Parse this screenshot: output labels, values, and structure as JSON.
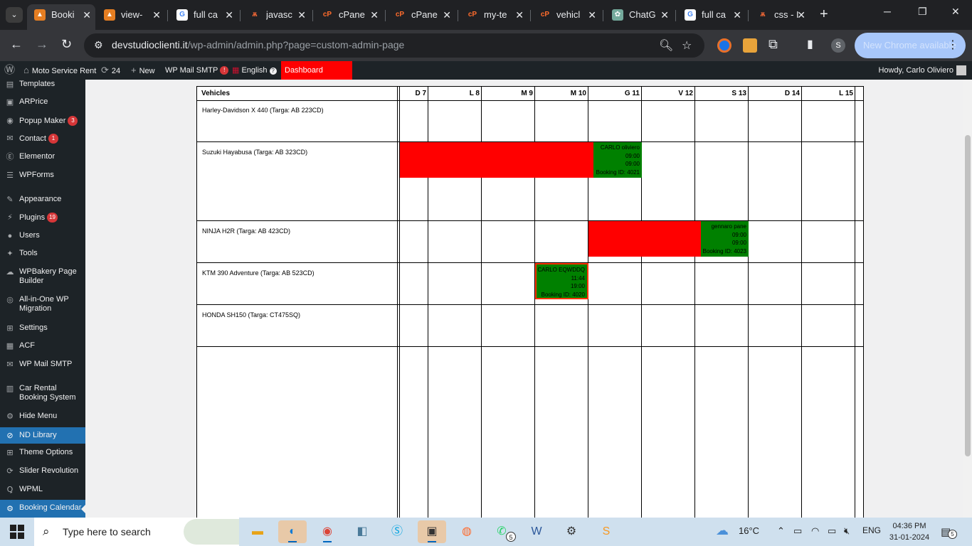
{
  "browser": {
    "tabs": [
      {
        "title": "Booki",
        "favicon": "orange-icon",
        "active": true
      },
      {
        "title": "view-",
        "favicon": "orange-icon"
      },
      {
        "title": "full ca",
        "favicon": "google-icon"
      },
      {
        "title": "javasc",
        "favicon": "dev-icon"
      },
      {
        "title": "cPane",
        "favicon": "cpanel-icon"
      },
      {
        "title": "cPane",
        "favicon": "cpanel-icon"
      },
      {
        "title": "my-te",
        "favicon": "cpanel-icon"
      },
      {
        "title": "vehicl",
        "favicon": "cpanel-icon"
      },
      {
        "title": "ChatG",
        "favicon": "chatgpt-icon"
      },
      {
        "title": "full ca",
        "favicon": "google-icon"
      },
      {
        "title": "css - I",
        "favicon": "dev-icon"
      }
    ],
    "url_domain": "devstudioclienti.it",
    "url_path": "/wp-admin/admin.php?page=custom-admin-page",
    "profile_initial": "S",
    "update_label": "New Chrome available"
  },
  "wp_bar": {
    "site_name": "Moto Service Rent",
    "updates_count": "24",
    "new_label": "New",
    "smtp_label": "WP Mail SMTP",
    "smtp_badge": "!",
    "language": "English",
    "dashboard_label": "Dashboard Noleggio",
    "howdy": "Howdy, Carlo Oliviero"
  },
  "sidebar": {
    "items": [
      {
        "label": "Templates",
        "icon": "templates-icon"
      },
      {
        "label": "ARPrice",
        "icon": "arprice-icon"
      },
      {
        "label": "Popup Maker",
        "icon": "popup-icon",
        "count": "3"
      },
      {
        "label": "Contact",
        "icon": "mail-icon",
        "count": "1"
      },
      {
        "label": "Elementor",
        "icon": "elementor-icon"
      },
      {
        "label": "WPForms",
        "icon": "forms-icon"
      },
      {
        "label": "Appearance",
        "icon": "brush-icon"
      },
      {
        "label": "Plugins",
        "icon": "plug-icon",
        "count": "19"
      },
      {
        "label": "Users",
        "icon": "user-icon"
      },
      {
        "label": "Tools",
        "icon": "wrench-icon"
      },
      {
        "label": "WPBakery Page Builder",
        "icon": "cloud-icon"
      },
      {
        "label": "All-in-One WP Migration",
        "icon": "migration-icon"
      },
      {
        "label": "Settings",
        "icon": "settings-icon"
      },
      {
        "label": "ACF",
        "icon": "acf-icon"
      },
      {
        "label": "WP Mail SMTP",
        "icon": "smtp-icon"
      },
      {
        "label": "Car Rental Booking System",
        "icon": "car-rental-icon"
      },
      {
        "label": "Hide Menu",
        "icon": "gear-icon"
      },
      {
        "label": "ND Library",
        "icon": "library-icon",
        "selected": true
      },
      {
        "label": "Theme Options",
        "icon": "grid-icon"
      },
      {
        "label": "Slider Revolution",
        "icon": "slider-icon"
      },
      {
        "label": "WPML",
        "icon": "wpml-icon"
      },
      {
        "label": "Booking Calendar",
        "icon": "gear-icon",
        "selected": true
      }
    ]
  },
  "calendar": {
    "header_vehicles": "Vehicles",
    "days": [
      "D 7",
      "L 8",
      "M 9",
      "M 10",
      "G 11",
      "V 12",
      "S 13",
      "D 14",
      "L 15"
    ],
    "vehicles": [
      "Harley-Davidson X 440 (Targa: AB 223CD)",
      "Suzuki Hayabusa (Targa: AB 323CD)",
      "NINJA H2R (Targa: AB 423CD)",
      "KTM 390 Adventure (Targa: AB 523CD)",
      "HONDA SH150 (Targa: CT475SQ)"
    ],
    "bookings": [
      {
        "customer": "CARLO oliviero",
        "start_time": "09:00",
        "end_time": "09:00",
        "booking_id": "Booking ID: 4021"
      },
      {
        "customer": "gennaro pane",
        "start_time": "09:00",
        "end_time": "09:00",
        "booking_id": "Booking ID: 4023"
      },
      {
        "customer": "CARLO EQWDDQ",
        "start_time": "11:44",
        "end_time": "19:00",
        "booking_id": "Booking ID: 4020"
      }
    ]
  },
  "taskbar": {
    "search_placeholder": "Type here to search",
    "weather": "16°C",
    "language": "ENG",
    "time": "04:36 PM",
    "date": "31-01-2024",
    "notifications": "5",
    "whatsapp_badge": "5"
  }
}
